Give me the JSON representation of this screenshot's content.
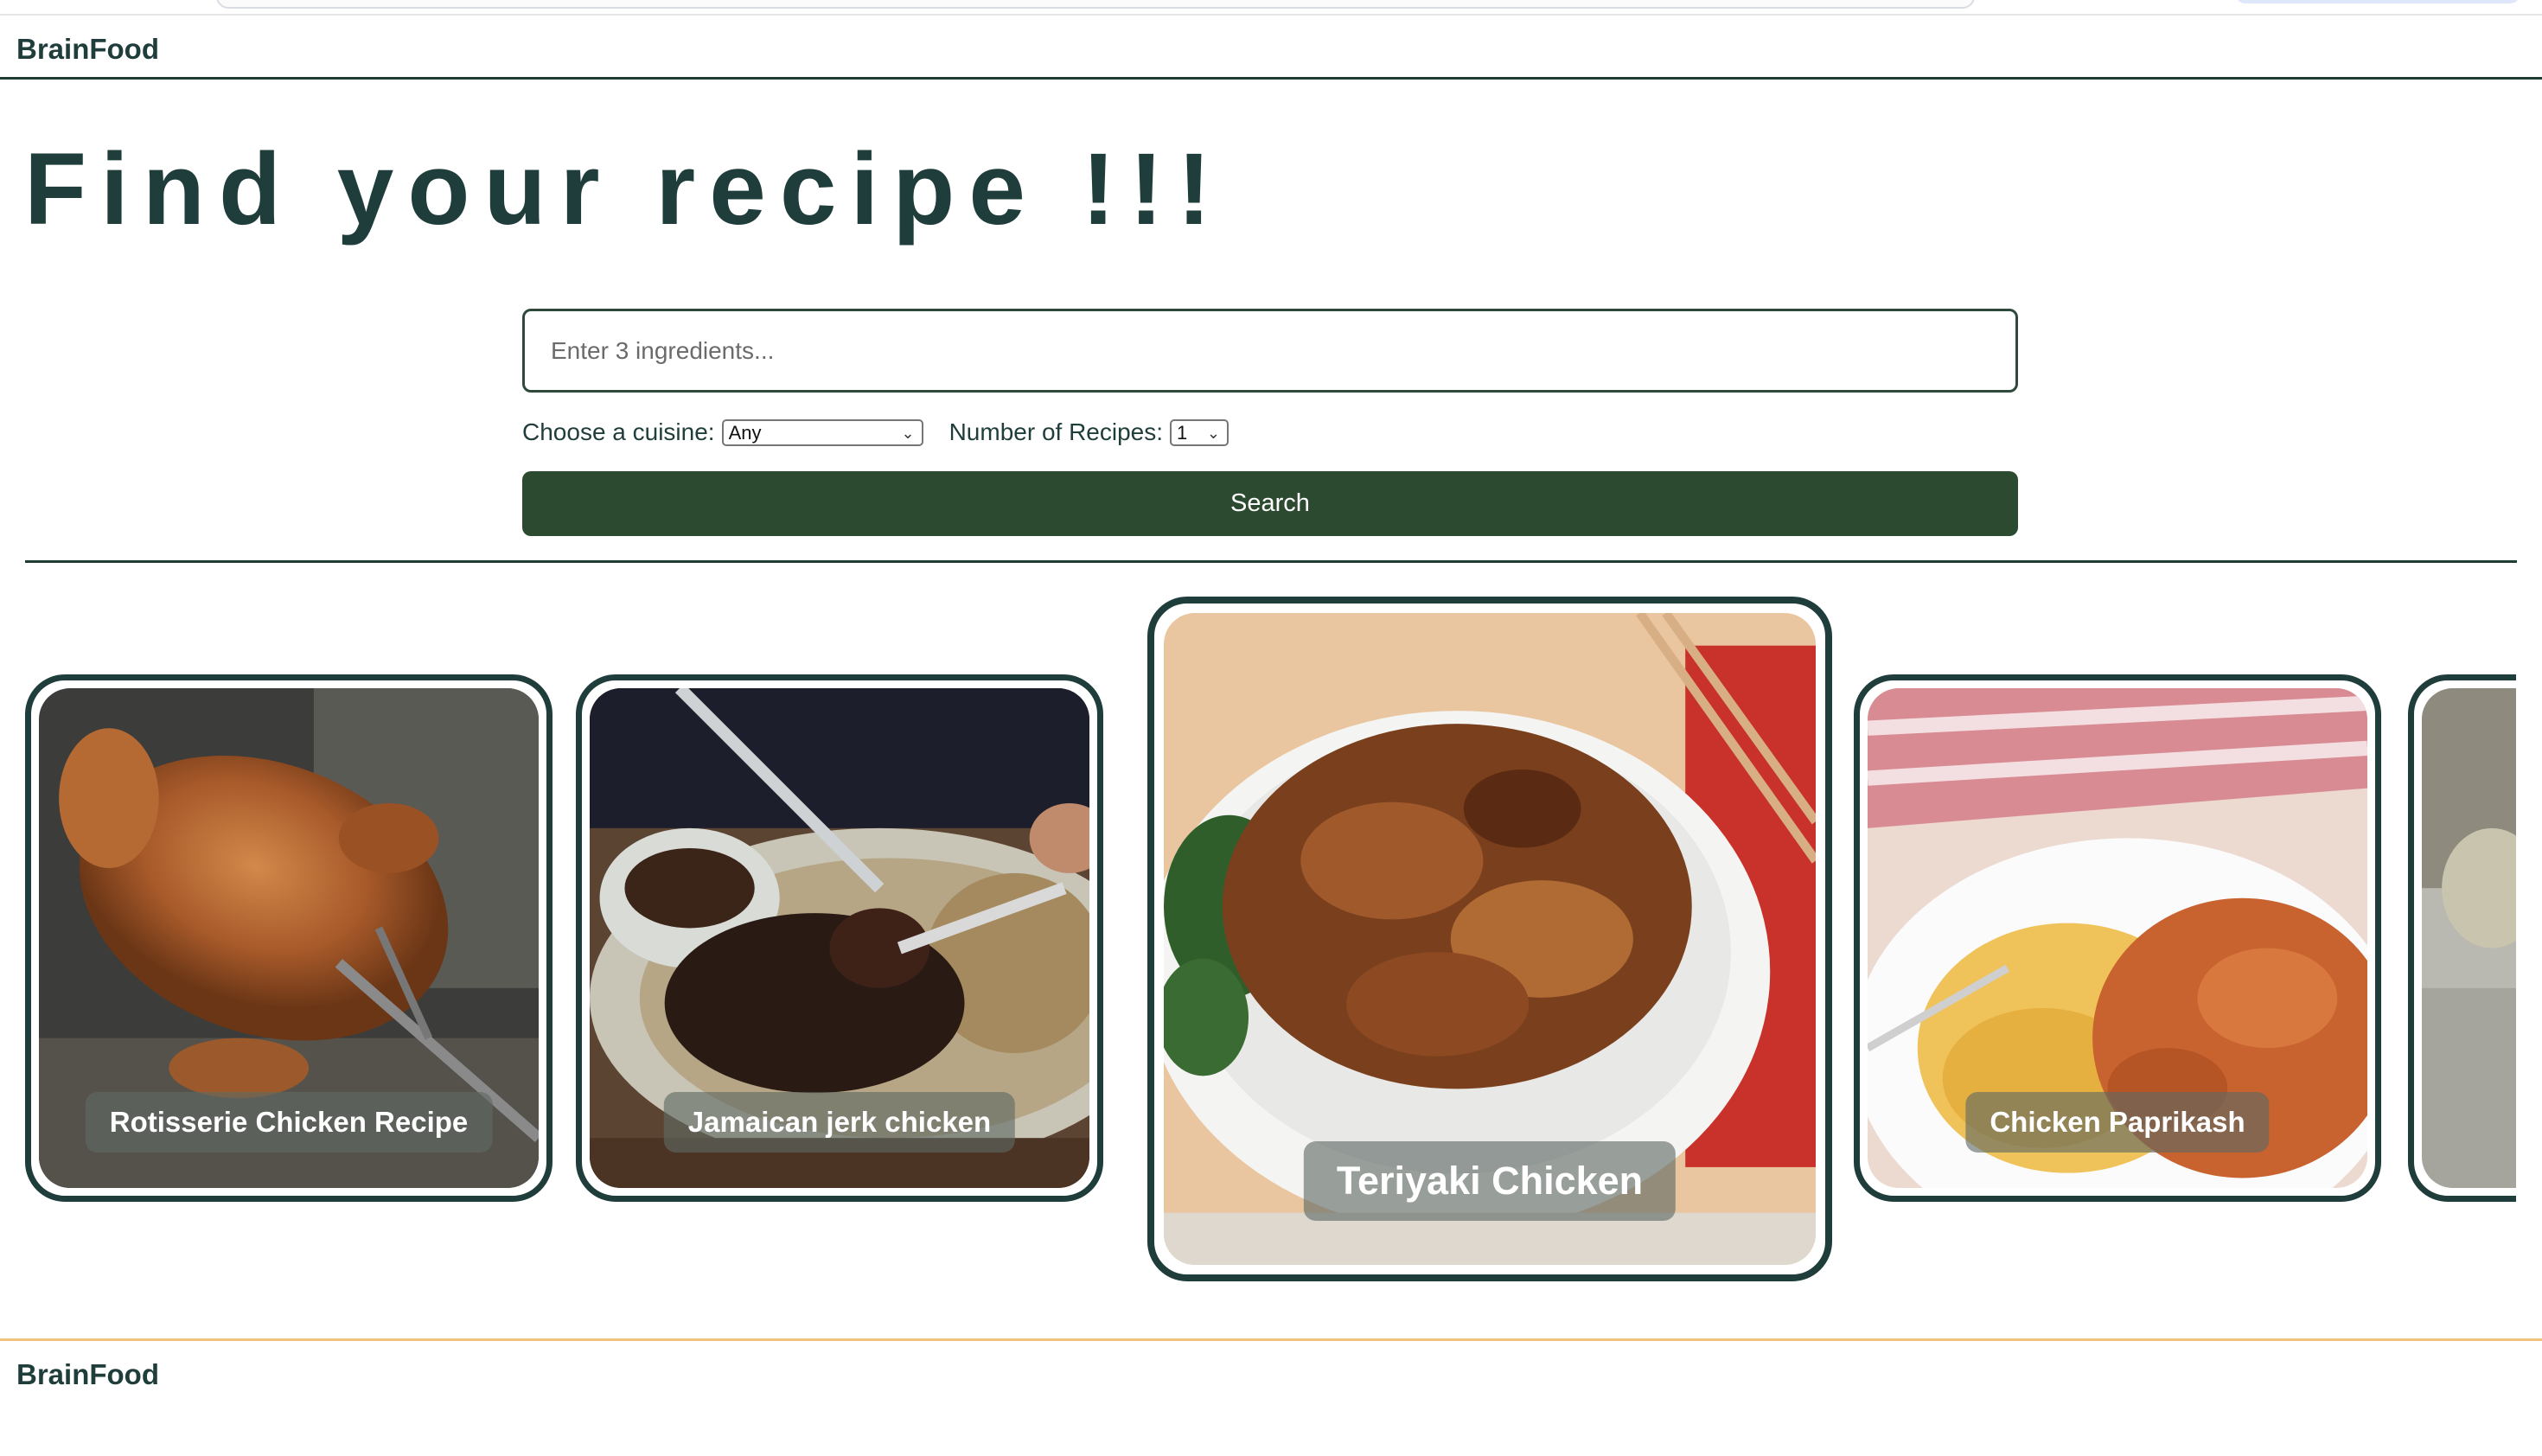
{
  "header": {
    "brand": "BrainFood"
  },
  "hero": {
    "title": "Find your recipe !!!"
  },
  "search": {
    "placeholder": "Enter 3 ingredients...",
    "value": ""
  },
  "filters": {
    "cuisine_label": "Choose a cuisine:",
    "cuisine_value": "Any",
    "count_label": "Number of Recipes:",
    "count_value": "1"
  },
  "search_button": {
    "label": "Search"
  },
  "recipes": [
    {
      "title": "Rotisserie Chicken Recipe",
      "image": "rotisserie-chicken-photo"
    },
    {
      "title": "Jamaican jerk chicken",
      "image": "jerk-chicken-photo"
    },
    {
      "title": "Teriyaki Chicken",
      "image": "teriyaki-chicken-photo",
      "featured": true
    },
    {
      "title": "Chicken Paprikash",
      "image": "chicken-paprikash-photo"
    },
    {
      "title": "",
      "image": "partial-next-recipe-photo"
    }
  ],
  "footer": {
    "brand": "BrainFood"
  },
  "colors": {
    "brand_dark": "#1f3d3a",
    "button_green": "#2c4a30",
    "footer_accent": "#f1c27d"
  }
}
